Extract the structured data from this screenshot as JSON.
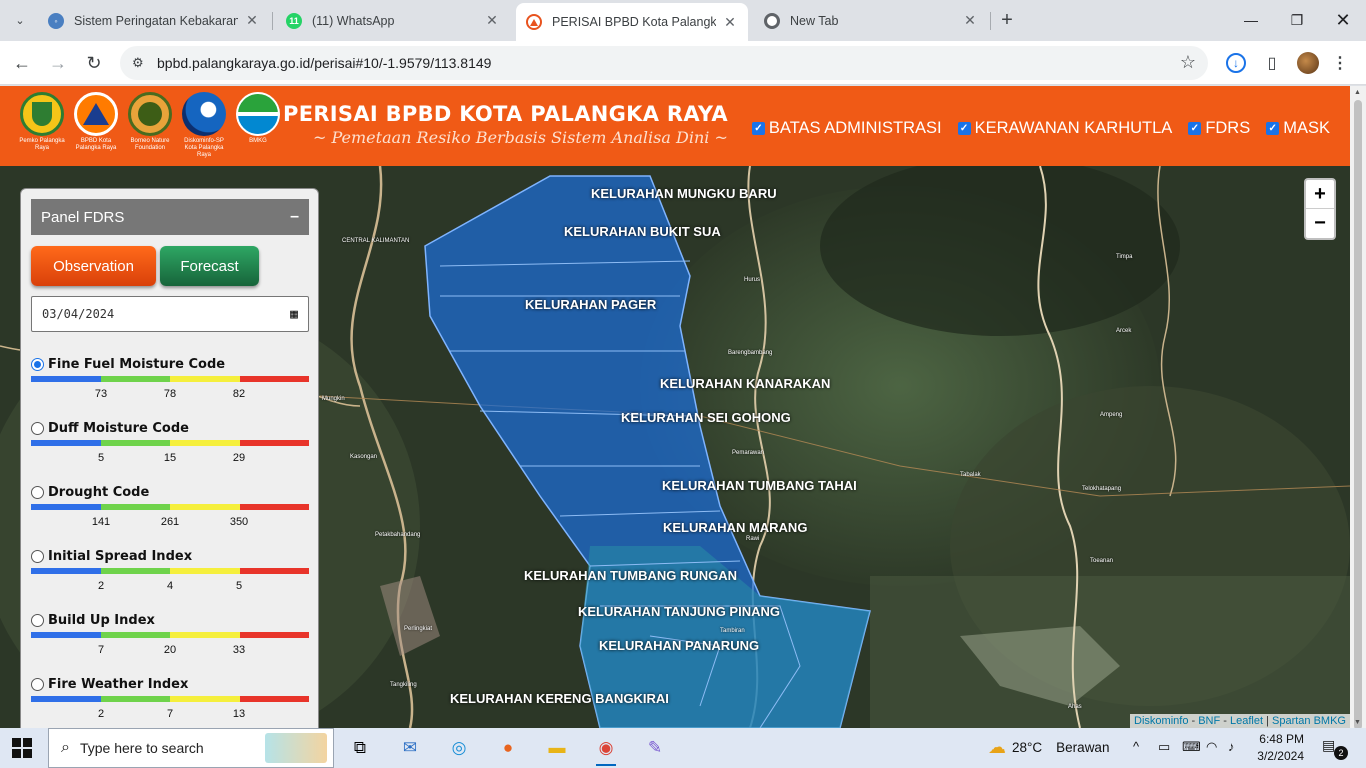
{
  "browser": {
    "tabs": [
      {
        "title": "Sistem Peringatan Kebakaran H",
        "active": false,
        "favicon": "globe-icon",
        "color": "#4a7fc1"
      },
      {
        "title": "(11) WhatsApp",
        "active": false,
        "favicon": "whatsapp-icon",
        "color": "#25d366",
        "badge": "11"
      },
      {
        "title": "PERISAI BPBD Kota Palangka Ra",
        "active": true,
        "favicon": "bpbd-icon",
        "color": "#e8531e"
      },
      {
        "title": "New Tab",
        "active": false,
        "favicon": "chrome-icon",
        "color": "#5f6368"
      }
    ],
    "url": "bpbd.palangkaraya.go.id/perisai#10/-1.9579/113.8149"
  },
  "header": {
    "title": "PERISAI BPBD KOTA PALANGKA RAYA",
    "subtitle": "~ Pemetaan Resiko Berbasis Sistem Analisa Dini ~",
    "logos": [
      {
        "caption": "Pemko Palangka Raya",
        "color": "#2e7d32"
      },
      {
        "caption": "BPBD Kota Palangka Raya",
        "color": "#d84315"
      },
      {
        "caption": "Borneo Nature Foundation",
        "color": "#558b2f"
      },
      {
        "caption": "Diskominfo-SP Kota Palangka Raya",
        "color": "#1565c0"
      },
      {
        "caption": "BMKG",
        "color": "#0288d1"
      }
    ],
    "layers": [
      {
        "label": "BATAS ADMINISTRASI",
        "checked": true
      },
      {
        "label": "KERAWANAN KARHUTLA",
        "checked": true
      },
      {
        "label": "FDRS",
        "checked": true
      },
      {
        "label": "MASK",
        "checked": true
      }
    ]
  },
  "panel": {
    "title": "Panel FDRS",
    "collapse": "–",
    "observation_label": "Observation",
    "forecast_label": "Forecast",
    "date_value": "03/04/2024",
    "scale_colors": [
      "#2f6fe8",
      "#6fd34b",
      "#f5ef3c",
      "#e8342a"
    ],
    "indices": [
      {
        "name": "Fine Fuel Moisture Code",
        "selected": true,
        "ticks": [
          "73",
          "78",
          "82"
        ]
      },
      {
        "name": "Duff Moisture Code",
        "selected": false,
        "ticks": [
          "5",
          "15",
          "29"
        ]
      },
      {
        "name": "Drought Code",
        "selected": false,
        "ticks": [
          "141",
          "261",
          "350"
        ]
      },
      {
        "name": "Initial Spread Index",
        "selected": false,
        "ticks": [
          "2",
          "4",
          "5"
        ]
      },
      {
        "name": "Build Up Index",
        "selected": false,
        "ticks": [
          "7",
          "20",
          "33"
        ]
      },
      {
        "name": "Fire Weather Index",
        "selected": false,
        "ticks": [
          "2",
          "7",
          "13"
        ]
      }
    ]
  },
  "map": {
    "kelurahan": [
      "KELURAHAN MUNGKU BARU",
      "KELURAHAN BUKIT SUA",
      "KELURAHAN PAGER",
      "KELURAHAN KANARAKAN",
      "KELURAHAN SEI GOHONG",
      "KELURAHAN TUMBANG TAHAI",
      "KELURAHAN MARANG",
      "KELURAHAN TUMBANG RUNGAN",
      "KELURAHAN TANJUNG PINANG",
      "KELURAHAN PANARUNG",
      "KELURAHAN KERENG BANGKIRAI"
    ],
    "places": [
      "CENTRAL KALIMANTAN",
      "Hurus",
      "Timpa",
      "Arcek",
      "Barengbambang",
      "Mungkin",
      "Ampeng",
      "Kasongan",
      "Pemarawan",
      "Tabalak",
      "Petakbahandang",
      "Rawi",
      "Toeanan",
      "Perlingkiat",
      "Tangkiling",
      "Tambiran",
      "Ahas",
      "Telokhatapang"
    ],
    "zoom_in": "+",
    "zoom_out": "−",
    "attribution": [
      "Diskominfo",
      "BNF",
      "Leaflet",
      "Spartan BMKG"
    ],
    "attribution_sep": " - ",
    "attribution_bar": " | "
  },
  "taskbar": {
    "search_placeholder": "Type here to search",
    "temperature": "28°C",
    "weather": "Berawan",
    "time": "6:48 PM",
    "date": "3/2/2024",
    "notifications": "2"
  }
}
